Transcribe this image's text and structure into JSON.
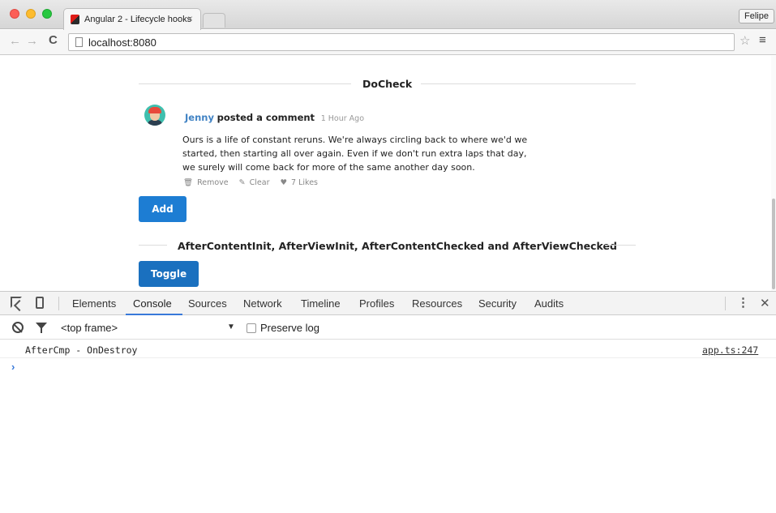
{
  "browser": {
    "tab_title": "Angular 2 - Lifecycle hooks",
    "tab_close": "×",
    "profile": "Felipe",
    "url": "localhost:8080"
  },
  "page": {
    "docheck_title": "DoCheck",
    "comment": {
      "author": "Jenny",
      "action": "posted a comment",
      "time": "1 Hour Ago",
      "text": "Ours is a life of constant reruns. We're always circling back to where we'd we started, then starting all over again. Even if we don't run extra laps that day, we surely will come back for more of the same another day soon.",
      "remove": "Remove",
      "clear": "Clear",
      "likes": "7 Likes"
    },
    "add_label": "Add",
    "after_title": "AfterContentInit, AfterViewInit, AfterContentChecked and AfterViewChecked",
    "toggle_label": "Toggle"
  },
  "devtools": {
    "tabs": [
      "Elements",
      "Console",
      "Sources",
      "Network",
      "Timeline",
      "Profiles",
      "Resources",
      "Security",
      "Audits"
    ],
    "active_tab": "Console",
    "frame": "<top frame>",
    "preserve_log": "Preserve log",
    "console": {
      "message": "AfterCmp - OnDestroy",
      "source": "app.ts:247"
    }
  }
}
